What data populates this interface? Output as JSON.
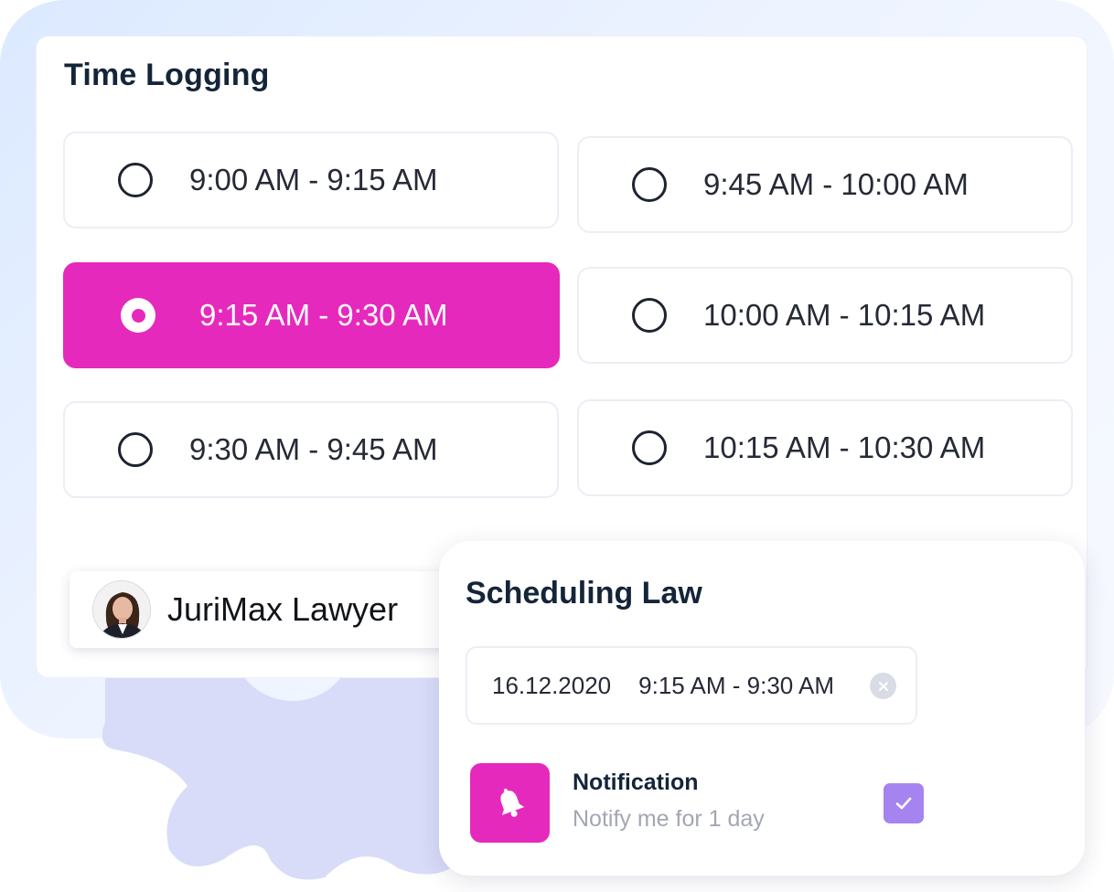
{
  "time_logging": {
    "title": "Time Logging",
    "slots": [
      {
        "label": "9:00 AM - 9:15 AM",
        "selected": false
      },
      {
        "label": "9:45 AM - 10:00 AM",
        "selected": false
      },
      {
        "label": "9:15 AM - 9:30 AM",
        "selected": true
      },
      {
        "label": "10:00 AM - 10:15 AM",
        "selected": false
      },
      {
        "label": "9:30 AM - 9:45 AM",
        "selected": false
      },
      {
        "label": "10:15 AM - 10:30 AM",
        "selected": false
      }
    ]
  },
  "lawyer": {
    "name": "JuriMax Lawyer",
    "avatar_icon": "person-avatar"
  },
  "scheduling": {
    "title": "Scheduling Law",
    "date": "16.12.2020",
    "time_range": "9:15 AM - 9:30 AM",
    "clear_icon": "close-icon",
    "notification": {
      "title": "Notification",
      "subtitle": "Notify me for 1 day",
      "icon": "bell-icon",
      "checked": true
    }
  },
  "colors": {
    "accent_pink": "#e629bd",
    "check_purple": "#a584f0",
    "title_navy": "#14253a",
    "gear_lavender": "#d8dcf8"
  }
}
